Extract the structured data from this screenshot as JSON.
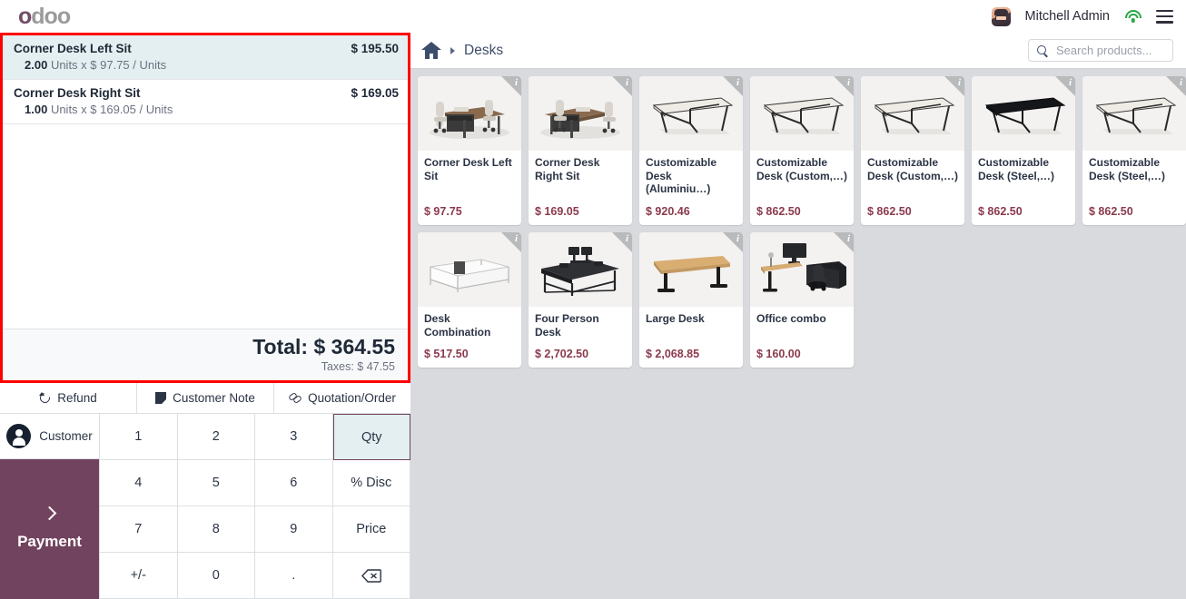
{
  "topbar": {
    "logo_o": "o",
    "logo_rest": "doo",
    "username": "Mitchell Admin",
    "avatar_name": "user-avatar",
    "wifi_icon": "wifi-icon",
    "menu_icon": "hamburger-menu-icon",
    "wifi_color": "#28a745"
  },
  "order": {
    "lines": [
      {
        "name": "Corner Desk Left Sit",
        "price": "$ 195.50",
        "qty": "2.00",
        "detail": "Units x $ 97.75 / Units",
        "selected": true
      },
      {
        "name": "Corner Desk Right Sit",
        "price": "$ 169.05",
        "qty": "1.00",
        "detail": "Units x $ 169.05 / Units",
        "selected": false
      }
    ],
    "total_label": "Total: $ 364.55",
    "taxes_label": "Taxes: $ 47.55",
    "highlight_border_color": "#ff0000",
    "selected_row_color": "#e4eff1"
  },
  "actions": [
    {
      "label": "Refund",
      "icon": "refund-icon"
    },
    {
      "label": "Customer Note",
      "icon": "note-icon"
    },
    {
      "label": "Quotation/Order",
      "icon": "link-icon"
    }
  ],
  "pad": {
    "customer_label": "Customer",
    "customer_icon": "person-icon",
    "payment_label": "Payment",
    "payment_icon": "chevron-right-icon",
    "payment_color": "#71435e",
    "keys": [
      {
        "label": "1",
        "name": "key-1",
        "selected": false
      },
      {
        "label": "2",
        "name": "key-2",
        "selected": false
      },
      {
        "label": "3",
        "name": "key-3",
        "selected": false
      },
      {
        "label": "Qty",
        "name": "key-qty",
        "selected": true
      },
      {
        "label": "4",
        "name": "key-4",
        "selected": false
      },
      {
        "label": "5",
        "name": "key-5",
        "selected": false
      },
      {
        "label": "6",
        "name": "key-6",
        "selected": false
      },
      {
        "label": "% Disc",
        "name": "key-discount",
        "selected": false
      },
      {
        "label": "7",
        "name": "key-7",
        "selected": false
      },
      {
        "label": "8",
        "name": "key-8",
        "selected": false
      },
      {
        "label": "9",
        "name": "key-9",
        "selected": false
      },
      {
        "label": "Price",
        "name": "key-price",
        "selected": false
      },
      {
        "label": "+/-",
        "name": "key-sign",
        "selected": false
      },
      {
        "label": "0",
        "name": "key-0",
        "selected": false
      },
      {
        "label": ".",
        "name": "key-decimal",
        "selected": false
      },
      {
        "label": "",
        "name": "key-backspace",
        "selected": false,
        "icon": "backspace-icon"
      }
    ]
  },
  "right": {
    "breadcrumb": {
      "home_icon": "home-icon",
      "arrow_icon": "chevron-right-icon",
      "category": "Desks"
    },
    "search": {
      "placeholder": "Search products...",
      "value": "",
      "icon": "search-icon"
    },
    "products": [
      {
        "name": "Corner Desk Left Sit",
        "price": "$ 97.75",
        "art": "corner-desk-left"
      },
      {
        "name": "Corner Desk Right Sit",
        "price": "$ 169.05",
        "art": "corner-desk-right"
      },
      {
        "name": "Customizable Desk (Aluminiu…)",
        "price": "$ 920.46",
        "art": "plain-desk-light"
      },
      {
        "name": "Customizable Desk (Custom,…)",
        "price": "$ 862.50",
        "art": "plain-desk-light"
      },
      {
        "name": "Customizable Desk (Custom,…)",
        "price": "$ 862.50",
        "art": "plain-desk-light"
      },
      {
        "name": "Customizable Desk (Steel,…)",
        "price": "$ 862.50",
        "art": "plain-desk-dark"
      },
      {
        "name": "Customizable Desk (Steel,…)",
        "price": "$ 862.50",
        "art": "plain-desk-light"
      },
      {
        "name": "Desk Combination",
        "price": "$ 517.50",
        "art": "desk-combination"
      },
      {
        "name": "Four Person Desk",
        "price": "$ 2,702.50",
        "art": "four-person-desk"
      },
      {
        "name": "Large Desk",
        "price": "$ 2,068.85",
        "art": "large-desk"
      },
      {
        "name": "Office combo",
        "price": "$ 160.00",
        "art": "office-combo"
      }
    ],
    "info_badge": "i",
    "background_color": "#d8dadd"
  }
}
